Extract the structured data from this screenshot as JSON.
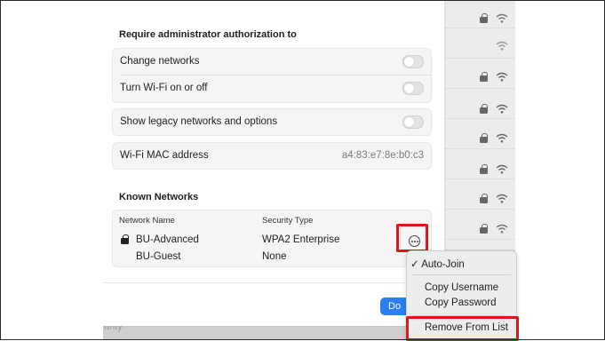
{
  "admin": {
    "title": "Require administrator authorization to",
    "change_networks": "Change networks",
    "turn_wifi": "Turn Wi-Fi on or off"
  },
  "legacy": {
    "label": "Show legacy networks and options"
  },
  "mac": {
    "label": "Wi-Fi MAC address",
    "value": "a4:83:e7:8e:b0:c3"
  },
  "known": {
    "title": "Known Networks",
    "col_name": "Network Name",
    "col_security": "Security Type",
    "networks": [
      {
        "name": "BU-Advanced",
        "security": "WPA2 Enterprise",
        "locked": true
      },
      {
        "name": "BU-Guest",
        "security": "None",
        "locked": false
      }
    ]
  },
  "done_label": "Do",
  "backdrop_text": "urity",
  "menu": {
    "auto_join": "✓ Auto-Join",
    "copy_username": "Copy Username",
    "copy_password": "Copy Password",
    "remove": "Remove From List"
  },
  "colors": {
    "accent": "#2b7ef3",
    "highlight": "#e0161b"
  },
  "icons": [
    "lock-icon",
    "wifi-icon",
    "more-icon",
    "checkmark-icon"
  ]
}
